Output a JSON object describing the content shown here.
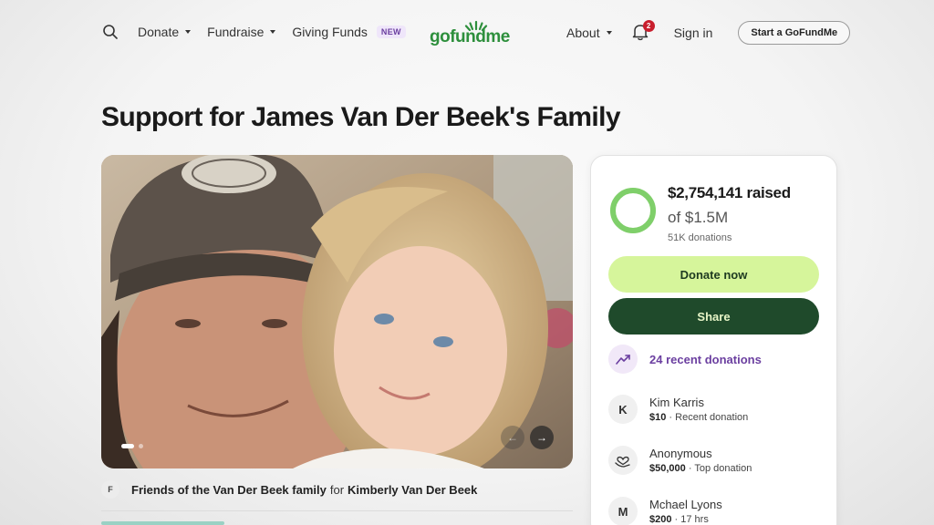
{
  "header": {
    "nav_left": [
      {
        "label": "Donate",
        "has_dropdown": true
      },
      {
        "label": "Fundraise",
        "has_dropdown": true
      },
      {
        "label": "Giving Funds",
        "has_dropdown": false,
        "badge": "NEW"
      }
    ],
    "logo_text": "gofundme",
    "about_label": "About",
    "notification_count": "2",
    "signin_label": "Sign in",
    "start_button_label": "Start a GoFundMe"
  },
  "page_title": "Support for James Van Der Beek's Family",
  "hero": {
    "slide_count": 3,
    "active_slide": 1
  },
  "organizer": {
    "avatar_initial": "F",
    "name": "Friends of the Van Der Beek family",
    "for_word": "for",
    "beneficiary": "Kimberly Van Der Beek"
  },
  "donation_panel": {
    "raised_text": "$2,754,141 raised",
    "goal_text": "of $1.5M",
    "donations_count": "51K donations",
    "progress_fraction": 1.0,
    "donate_button_label": "Donate now",
    "share_button_label": "Share",
    "recent_donations_label": "24 recent donations",
    "donors": [
      {
        "avatar": "K",
        "name": "Kim Karris",
        "amount": "$10",
        "note": "· Recent donation"
      },
      {
        "avatar": "heart-hand-icon",
        "name": "Anonymous",
        "amount": "$50,000",
        "note": "· Top donation"
      },
      {
        "avatar": "M",
        "name": "Mchael Lyons",
        "amount": "$200",
        "note": "· 17 hrs"
      }
    ]
  },
  "colors": {
    "brand_green": "#2d8f3c",
    "donate_button": "#d6f59b",
    "share_button": "#1f4a2b",
    "accent_purple": "#6b3fa0",
    "notification_red": "#c81e2d"
  }
}
